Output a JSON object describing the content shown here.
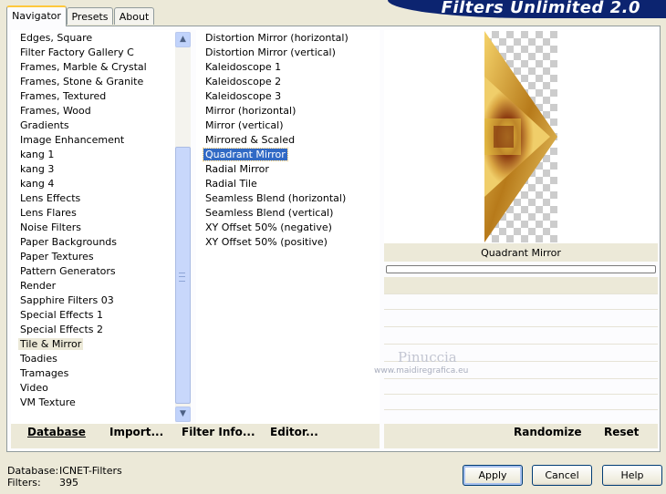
{
  "tabs": [
    "Navigator",
    "Presets",
    "About"
  ],
  "brand": "Filters Unlimited 2.0",
  "categories": [
    "Edges, Square",
    "Filter Factory Gallery C",
    "Frames, Marble & Crystal",
    "Frames, Stone & Granite",
    "Frames, Textured",
    "Frames, Wood",
    "Gradients",
    "Image Enhancement",
    "kang 1",
    "kang 3",
    "kang 4",
    "Lens Effects",
    "Lens Flares",
    "Noise Filters",
    "Paper Backgrounds",
    "Paper Textures",
    "Pattern Generators",
    "Render",
    "Sapphire Filters 03",
    "Special Effects 1",
    "Special Effects 2",
    "Tile & Mirror",
    "Toadies",
    "Tramages",
    "Video",
    "VM Texture"
  ],
  "selected_category": "Tile & Mirror",
  "filters": [
    "Distortion Mirror (horizontal)",
    "Distortion Mirror (vertical)",
    "Kaleidoscope 1",
    "Kaleidoscope 2",
    "Kaleidoscope 3",
    "Mirror (horizontal)",
    "Mirror (vertical)",
    "Mirrored & Scaled",
    "Quadrant Mirror",
    "Radial Mirror",
    "Radial Tile",
    "Seamless Blend (horizontal)",
    "Seamless Blend (vertical)",
    "XY Offset 50% (negative)",
    "XY Offset 50% (positive)"
  ],
  "selected_filter": "Quadrant Mirror",
  "preview_caption": "Quadrant Mirror",
  "watermark": {
    "name": "Pinuccia",
    "url": "www.maidiregrafica.eu"
  },
  "toolbar": {
    "database": "Database",
    "import": "Import...",
    "filter_info": "Filter Info...",
    "editor": "Editor...",
    "randomize": "Randomize",
    "reset": "Reset"
  },
  "status": {
    "database_label": "Database:",
    "database_value": "ICNET-Filters",
    "filters_label": "Filters:",
    "filters_value": "395"
  },
  "buttons": {
    "apply": "Apply",
    "cancel": "Cancel",
    "help": "Help"
  },
  "colors": {
    "brand_bg": "#0c2470",
    "selection": "#316ac5",
    "window_bg": "#ece9d8"
  }
}
